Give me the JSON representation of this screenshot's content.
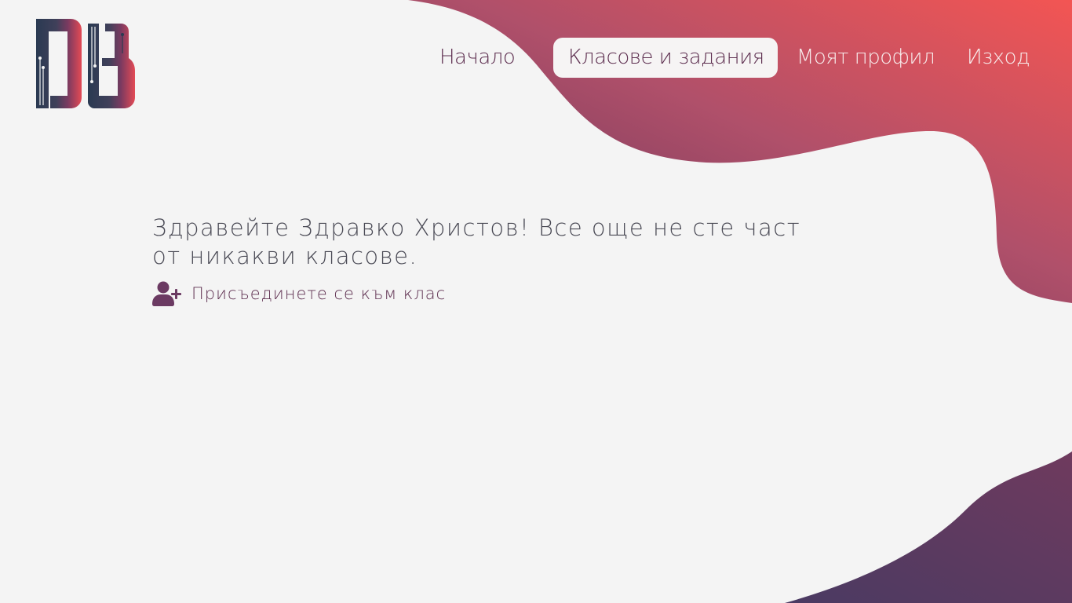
{
  "brand": {
    "logo_icon": "db-circuit-logo",
    "colors": {
      "background": "#f4f4f4",
      "gradient_dark": "#5b2e55",
      "gradient_light": "#f05454",
      "logo_dark": "#2a3a52",
      "text_primary": "#5d2e4f",
      "text_body": "#4a4a55"
    }
  },
  "nav": {
    "items": [
      {
        "label": "Начало",
        "active": false
      },
      {
        "label": "Класове и задания",
        "active": true
      },
      {
        "label": "Моят профил",
        "active": false
      },
      {
        "label": "Изход",
        "active": false
      }
    ]
  },
  "main": {
    "greeting": "Здравейте Здравко Христов! Все още не сте част от никакви класове.",
    "join_link": {
      "icon": "user-plus-icon",
      "label": "Присъединете се към клас"
    }
  }
}
